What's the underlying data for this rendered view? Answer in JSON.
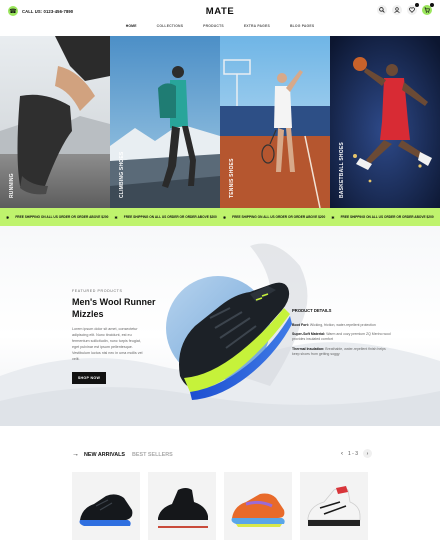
{
  "header": {
    "phone": "CALL US: 0123-456-7890",
    "logo": "MATE",
    "nav": [
      "HOME",
      "COLLECTIONS",
      "PRODUCTS",
      "EXTRA PAGES",
      "BLOG PAGES"
    ]
  },
  "hero": {
    "panels": [
      {
        "label": "RUNNING"
      },
      {
        "label": "CLIMBING SHOES"
      },
      {
        "label": "TENNIS SHOES"
      },
      {
        "label": "BASKETBALL SHOES"
      }
    ]
  },
  "marquee": {
    "text": "FREE SHIPPING ON ALL US ORDER OR ORDER ABOVE $200"
  },
  "featured": {
    "tag": "FEATURED PRODUCTS",
    "title": "Men's Wool Runner Mizzles",
    "description": "Lorem ipsum dolor sit amet, consectetur adipiscing elit. Nunc tincidunt, est eu fermentum sollicitudin, nunc turpis feugiat, eget pulvinar est ipsum pellentesque. Vestibulum luctus nisl nec in uma mollis vel velit.",
    "button": "SHOP NOW",
    "details_title": "PRODUCT DETAILS",
    "details": [
      {
        "label": "Boot Fort:",
        "text": " Wicking, friction, water-repellent protection"
      },
      {
        "label": "Super-Soft Material:",
        "text": " Warm and cozy premium ZQ Merino wool provides insulated comfort"
      },
      {
        "label": "Thermal Insulation:",
        "text": " Breathable, water-repellent finish helps keep shoes from getting soggy"
      }
    ]
  },
  "arrivals": {
    "tab_new": "NEW ARRIVALS",
    "tab_best": "BEST SELLERS",
    "pager": "1 - 3"
  },
  "colors": {
    "accent": "#bff36d",
    "dark": "#111111"
  }
}
